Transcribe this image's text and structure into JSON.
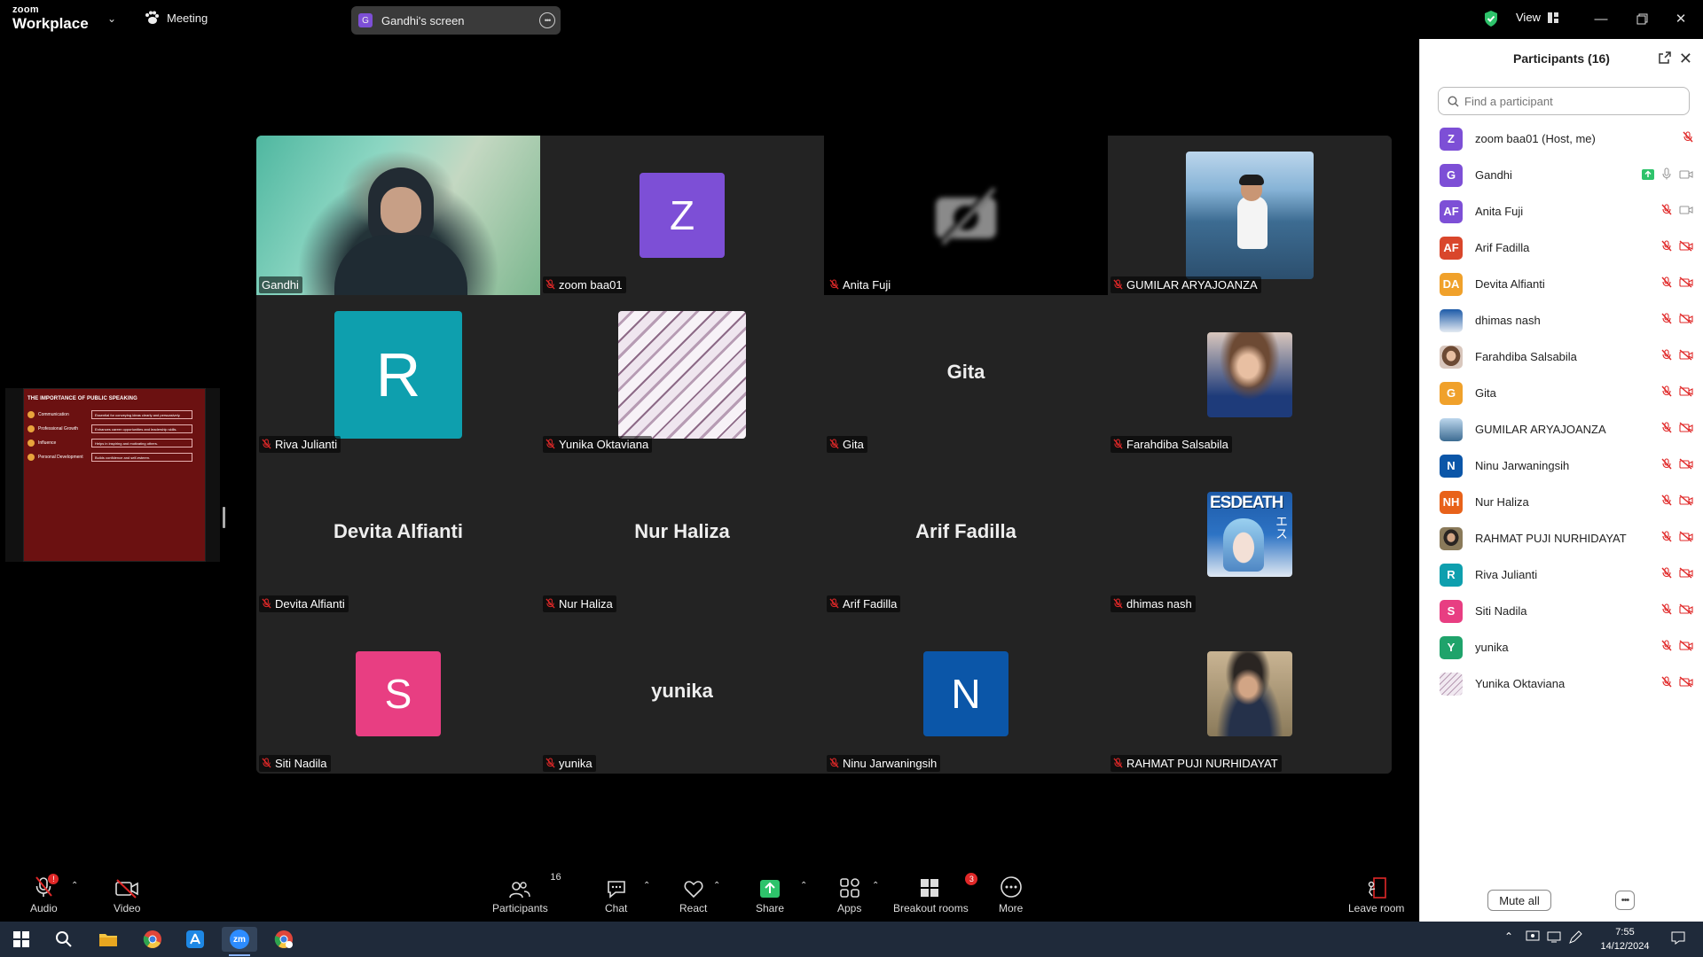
{
  "app": {
    "logo_line1": "zoom",
    "logo_line2": "Workplace"
  },
  "topbar": {
    "meeting_label": "Meeting",
    "share_label": "Gandhi's screen",
    "share_initial": "G",
    "view_label": "View"
  },
  "slide": {
    "title": "THE IMPORTANCE OF PUBLIC SPEAKING",
    "rows": [
      {
        "key": "Communication",
        "value": "Essential for conveying ideas clearly and persuasively."
      },
      {
        "key": "Professional Growth",
        "value": "Enhances career opportunities and leadership skills."
      },
      {
        "key": "Influence",
        "value": "Helps in inspiring and motivating others."
      },
      {
        "key": "Personal Development",
        "value": "Builds confidence and self-esteem."
      }
    ]
  },
  "tiles": [
    {
      "name": "Gandhi",
      "kind": "camera",
      "speaking": true,
      "muted": false
    },
    {
      "name": "zoom baa01",
      "kind": "avatar",
      "initial": "Z",
      "color": "#7d4fd6"
    },
    {
      "name": "Anita Fuji",
      "kind": "camoff"
    },
    {
      "name": "GUMILAR ARYAJOANZA",
      "kind": "photo",
      "photo": "sea"
    },
    {
      "name": "Riva Julianti",
      "kind": "avatar-huge",
      "initial": "R",
      "color": "#0e9fae"
    },
    {
      "name": "Yunika Oktaviana",
      "kind": "photo",
      "photo": "marble"
    },
    {
      "name": "Gita",
      "kind": "text",
      "display": "Gita"
    },
    {
      "name": "Farahdiba Salsabila",
      "kind": "photo",
      "photo": "portrait-f"
    },
    {
      "name": "Devita Alfianti",
      "kind": "text",
      "display": "Devita Alfianti"
    },
    {
      "name": "Nur Haliza",
      "kind": "text",
      "display": "Nur Haliza"
    },
    {
      "name": "Arif Fadilla",
      "kind": "text",
      "display": "Arif Fadilla"
    },
    {
      "name": "dhimas nash",
      "kind": "photo",
      "photo": "anime"
    },
    {
      "name": "Siti Nadila",
      "kind": "avatar",
      "initial": "S",
      "color": "#e83e82"
    },
    {
      "name": "yunika",
      "kind": "text",
      "display": "yunika"
    },
    {
      "name": "Ninu Jarwaningsih",
      "kind": "avatar",
      "initial": "N",
      "color": "#0b56a8"
    },
    {
      "name": "RAHMAT PUJI NURHIDAYAT",
      "kind": "photo",
      "photo": "portrait-m"
    }
  ],
  "anime_text": "ESDEATH",
  "anime_jp": "エス",
  "panel": {
    "title": "Participants (16)",
    "search_placeholder": "Find a participant",
    "mute_all": "Mute all",
    "participants": [
      {
        "name": "zoom baa01 (Host, me)",
        "initials": "Z",
        "color": "#7d4fd6",
        "icons": "host"
      },
      {
        "name": "Gandhi",
        "initials": "G",
        "color": "#7d4fd6",
        "icons": "sharing"
      },
      {
        "name": "Anita Fuji",
        "initials": "AF",
        "color": "#7d4fd6",
        "icons": "muted-vidon"
      },
      {
        "name": "Arif Fadilla",
        "initials": "AF",
        "color": "#d9462b",
        "icons": "muted"
      },
      {
        "name": "Devita Alfianti",
        "initials": "DA",
        "color": "#f0a12b",
        "icons": "muted"
      },
      {
        "name": "dhimas nash",
        "initials": "",
        "color": "#1b4f8a",
        "icons": "muted"
      },
      {
        "name": "Farahdiba Salsabila",
        "initials": "",
        "color": "#c99a84",
        "icons": "muted"
      },
      {
        "name": "Gita",
        "initials": "G",
        "color": "#f0a12b",
        "icons": "muted"
      },
      {
        "name": "GUMILAR ARYAJOANZA",
        "initials": "",
        "color": "#5a6f82",
        "icons": "muted"
      },
      {
        "name": "Ninu Jarwaningsih",
        "initials": "N",
        "color": "#0b56a8",
        "icons": "muted"
      },
      {
        "name": "Nur Haliza",
        "initials": "NH",
        "color": "#e8621a",
        "icons": "muted"
      },
      {
        "name": "RAHMAT PUJI NURHIDAYAT",
        "initials": "",
        "color": "#3a4a55",
        "icons": "muted"
      },
      {
        "name": "Riva Julianti",
        "initials": "R",
        "color": "#0e9fae",
        "icons": "muted"
      },
      {
        "name": "Siti Nadila",
        "initials": "S",
        "color": "#e83e82",
        "icons": "muted"
      },
      {
        "name": "yunika",
        "initials": "Y",
        "color": "#1fa36b",
        "icons": "muted"
      },
      {
        "name": "Yunika Oktaviana",
        "initials": "",
        "color": "#e8dde8",
        "icons": "muted"
      }
    ]
  },
  "toolbar": {
    "audio": "Audio",
    "video": "Video",
    "participants": "Participants",
    "participants_count": "16",
    "chat": "Chat",
    "react": "React",
    "share": "Share",
    "apps": "Apps",
    "breakout": "Breakout rooms",
    "breakout_badge": "3",
    "more": "More",
    "leave": "Leave room"
  },
  "taskbar": {
    "time": "7:55",
    "date": "14/12/2024",
    "zoom_label": "zm"
  },
  "colors": {
    "accent": "#0b5cff",
    "mute_red": "#e02828",
    "speaking": "#23d96b"
  }
}
